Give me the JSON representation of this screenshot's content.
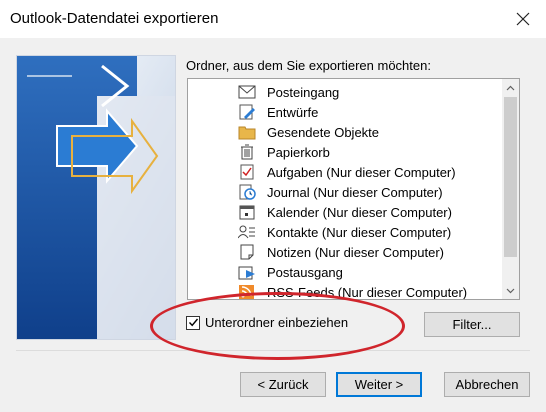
{
  "window": {
    "title": "Outlook-Datendatei exportieren"
  },
  "folders": {
    "label": "Ordner, aus dem Sie exportieren möchten:",
    "items": [
      {
        "label": "Posteingang",
        "icon": "inbox-icon"
      },
      {
        "label": "Entwürfe",
        "icon": "drafts-icon"
      },
      {
        "label": "Gesendete Objekte",
        "icon": "sent-folder-icon"
      },
      {
        "label": "Papierkorb",
        "icon": "trash-icon"
      },
      {
        "label": "Aufgaben (Nur dieser Computer)",
        "icon": "tasks-icon"
      },
      {
        "label": "Journal (Nur dieser Computer)",
        "icon": "journal-icon"
      },
      {
        "label": "Kalender (Nur dieser Computer)",
        "icon": "calendar-icon"
      },
      {
        "label": "Kontakte (Nur dieser Computer)",
        "icon": "contacts-icon"
      },
      {
        "label": "Notizen (Nur dieser Computer)",
        "icon": "notes-icon"
      },
      {
        "label": "Postausgang",
        "icon": "outbox-icon"
      },
      {
        "label": "RSS-Feeds (Nur dieser Computer)",
        "icon": "rss-icon"
      }
    ]
  },
  "options": {
    "include_subfolders_label": "Unterordner einbeziehen",
    "include_subfolders_checked": true
  },
  "buttons": {
    "filter": "Filter...",
    "back": "< Zurück",
    "next": "Weiter >",
    "cancel": "Abbrechen"
  },
  "colors": {
    "annotation": "#d0252c",
    "focus": "#0078d7"
  }
}
